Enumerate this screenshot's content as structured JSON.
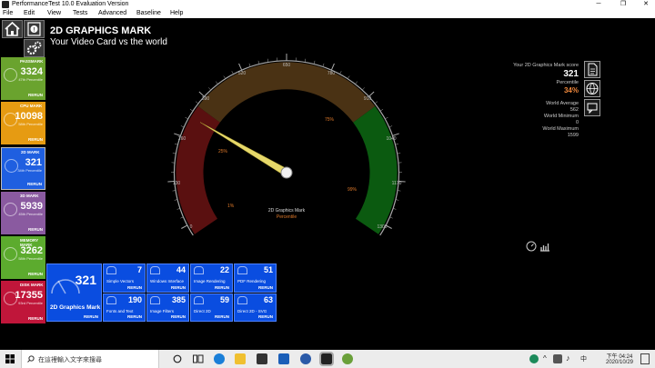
{
  "window": {
    "title": "PerformanceTest 10.0 Evaluation Version",
    "minimize": "─",
    "maximize": "❐",
    "close": "✕"
  },
  "menu": [
    "File",
    "Edit",
    "View",
    "Tests",
    "Advanced",
    "Baseline",
    "Help"
  ],
  "nav": {
    "home_icon": "home-icon",
    "info_icon": "info-icon",
    "settings_icon": "gear-icon"
  },
  "sidebar": [
    {
      "label": "PASSMARK",
      "value": "3324",
      "percentile": "47th Percentile",
      "rerun": "RERUN",
      "color": "#6aa32e"
    },
    {
      "label": "CPU MARK",
      "value": "10098",
      "percentile": "58th Percentile",
      "rerun": "RERUN",
      "color": "#e69b12"
    },
    {
      "label": "2D MARK",
      "value": "321",
      "percentile": "34th Percentile",
      "rerun": "RERUN",
      "color": "#1f5fe0"
    },
    {
      "label": "3D MARK",
      "value": "5939",
      "percentile": "45th Percentile",
      "rerun": "RERUN",
      "color": "#8a5aa0"
    },
    {
      "label": "MEMORY MARK",
      "value": "3262",
      "percentile": "58th Percentile",
      "rerun": "RERUN",
      "color": "#5cab2e"
    },
    {
      "label": "DISK MARK",
      "value": "17355",
      "percentile": "93rd Percentile",
      "rerun": "RERUN",
      "color": "#c0163a"
    }
  ],
  "heading": {
    "title": "2D GRAPHICS MARK",
    "subtitle": "Your Video Card vs the world"
  },
  "gauge": {
    "ticks": [
      "0",
      "130",
      "260",
      "390",
      "520",
      "650",
      "780",
      "910",
      "1040",
      "1170",
      "1300"
    ],
    "markers": [
      "1%",
      "25%",
      "75%",
      "99%"
    ],
    "center_title": "2D Graphics Mark",
    "center_sub": "Percentile",
    "value": 321,
    "max": 1300
  },
  "stats": {
    "score_label": "Your 2D Graphics Mark score",
    "score": "321",
    "percentile_label": "Percentile",
    "percentile": "34%",
    "avg_label": "World Average",
    "avg": "562",
    "min_label": "World Minimum",
    "min": "0",
    "max_label": "World Maximum",
    "max": "1599"
  },
  "bigtile": {
    "value": "321",
    "label": "2D Graphics Mark",
    "rerun": "RERUN"
  },
  "subtests": [
    {
      "value": "7",
      "name": "Simple Vectors",
      "rerun": "RERUN"
    },
    {
      "value": "44",
      "name": "Windows Interface",
      "rerun": "RERUN"
    },
    {
      "value": "22",
      "name": "Image Rendering",
      "rerun": "RERUN"
    },
    {
      "value": "51",
      "name": "PDF Rendering",
      "rerun": "RERUN"
    },
    {
      "value": "190",
      "name": "Fonts and Text",
      "rerun": "RERUN"
    },
    {
      "value": "385",
      "name": "Image Filters",
      "rerun": "RERUN"
    },
    {
      "value": "59",
      "name": "Direct 2D",
      "rerun": "RERUN"
    },
    {
      "value": "63",
      "name": "Direct 2D - SVG",
      "rerun": "RERUN"
    }
  ],
  "taskbar": {
    "search_placeholder": "在這裡輸入文字來搜尋",
    "time": "下午 04:24",
    "date": "2020/10/29",
    "ime": "中"
  }
}
